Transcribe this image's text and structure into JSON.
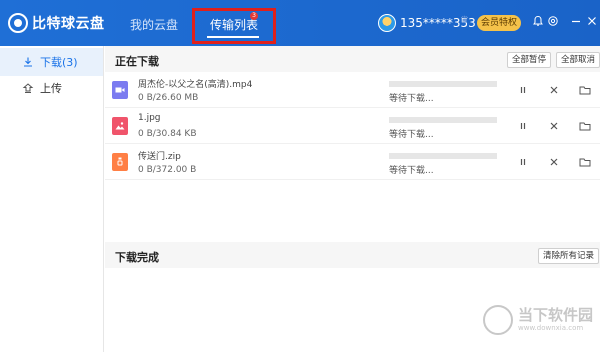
{
  "header": {
    "logo_text": "比特球云盘",
    "tabs": [
      {
        "label": "我的云盘"
      },
      {
        "label": "传输列表",
        "badge": "3"
      }
    ],
    "user_name": "135*****353",
    "vip_label": "会员特权"
  },
  "sidebar": {
    "items": [
      {
        "label": "下载(3)"
      },
      {
        "label": "上传"
      }
    ]
  },
  "downloading": {
    "title": "正在下载",
    "pause_all": "全部暂停",
    "cancel_all": "全部取消",
    "items": [
      {
        "name": "周杰伦-以父之名(高清).mp4",
        "size": "0 B/26.60 MB",
        "status": "等待下载...",
        "progress": 0,
        "type": "video"
      },
      {
        "name": "1.jpg",
        "size": "0 B/30.84 KB",
        "status": "等待下载...",
        "progress": 0,
        "type": "image"
      },
      {
        "name": "传送门.zip",
        "size": "0 B/372.00 B",
        "status": "等待下载...",
        "progress": 0,
        "type": "zip"
      }
    ]
  },
  "completed": {
    "title": "下载完成",
    "clear_all": "清除所有记录"
  },
  "watermark": {
    "title": "当下软件园",
    "url": "www.downxia.com"
  },
  "colors": {
    "topbar": "#1f6fd6",
    "accent": "#1a73e8",
    "highlight": "#e0201b",
    "vip": "#f5c24a"
  }
}
